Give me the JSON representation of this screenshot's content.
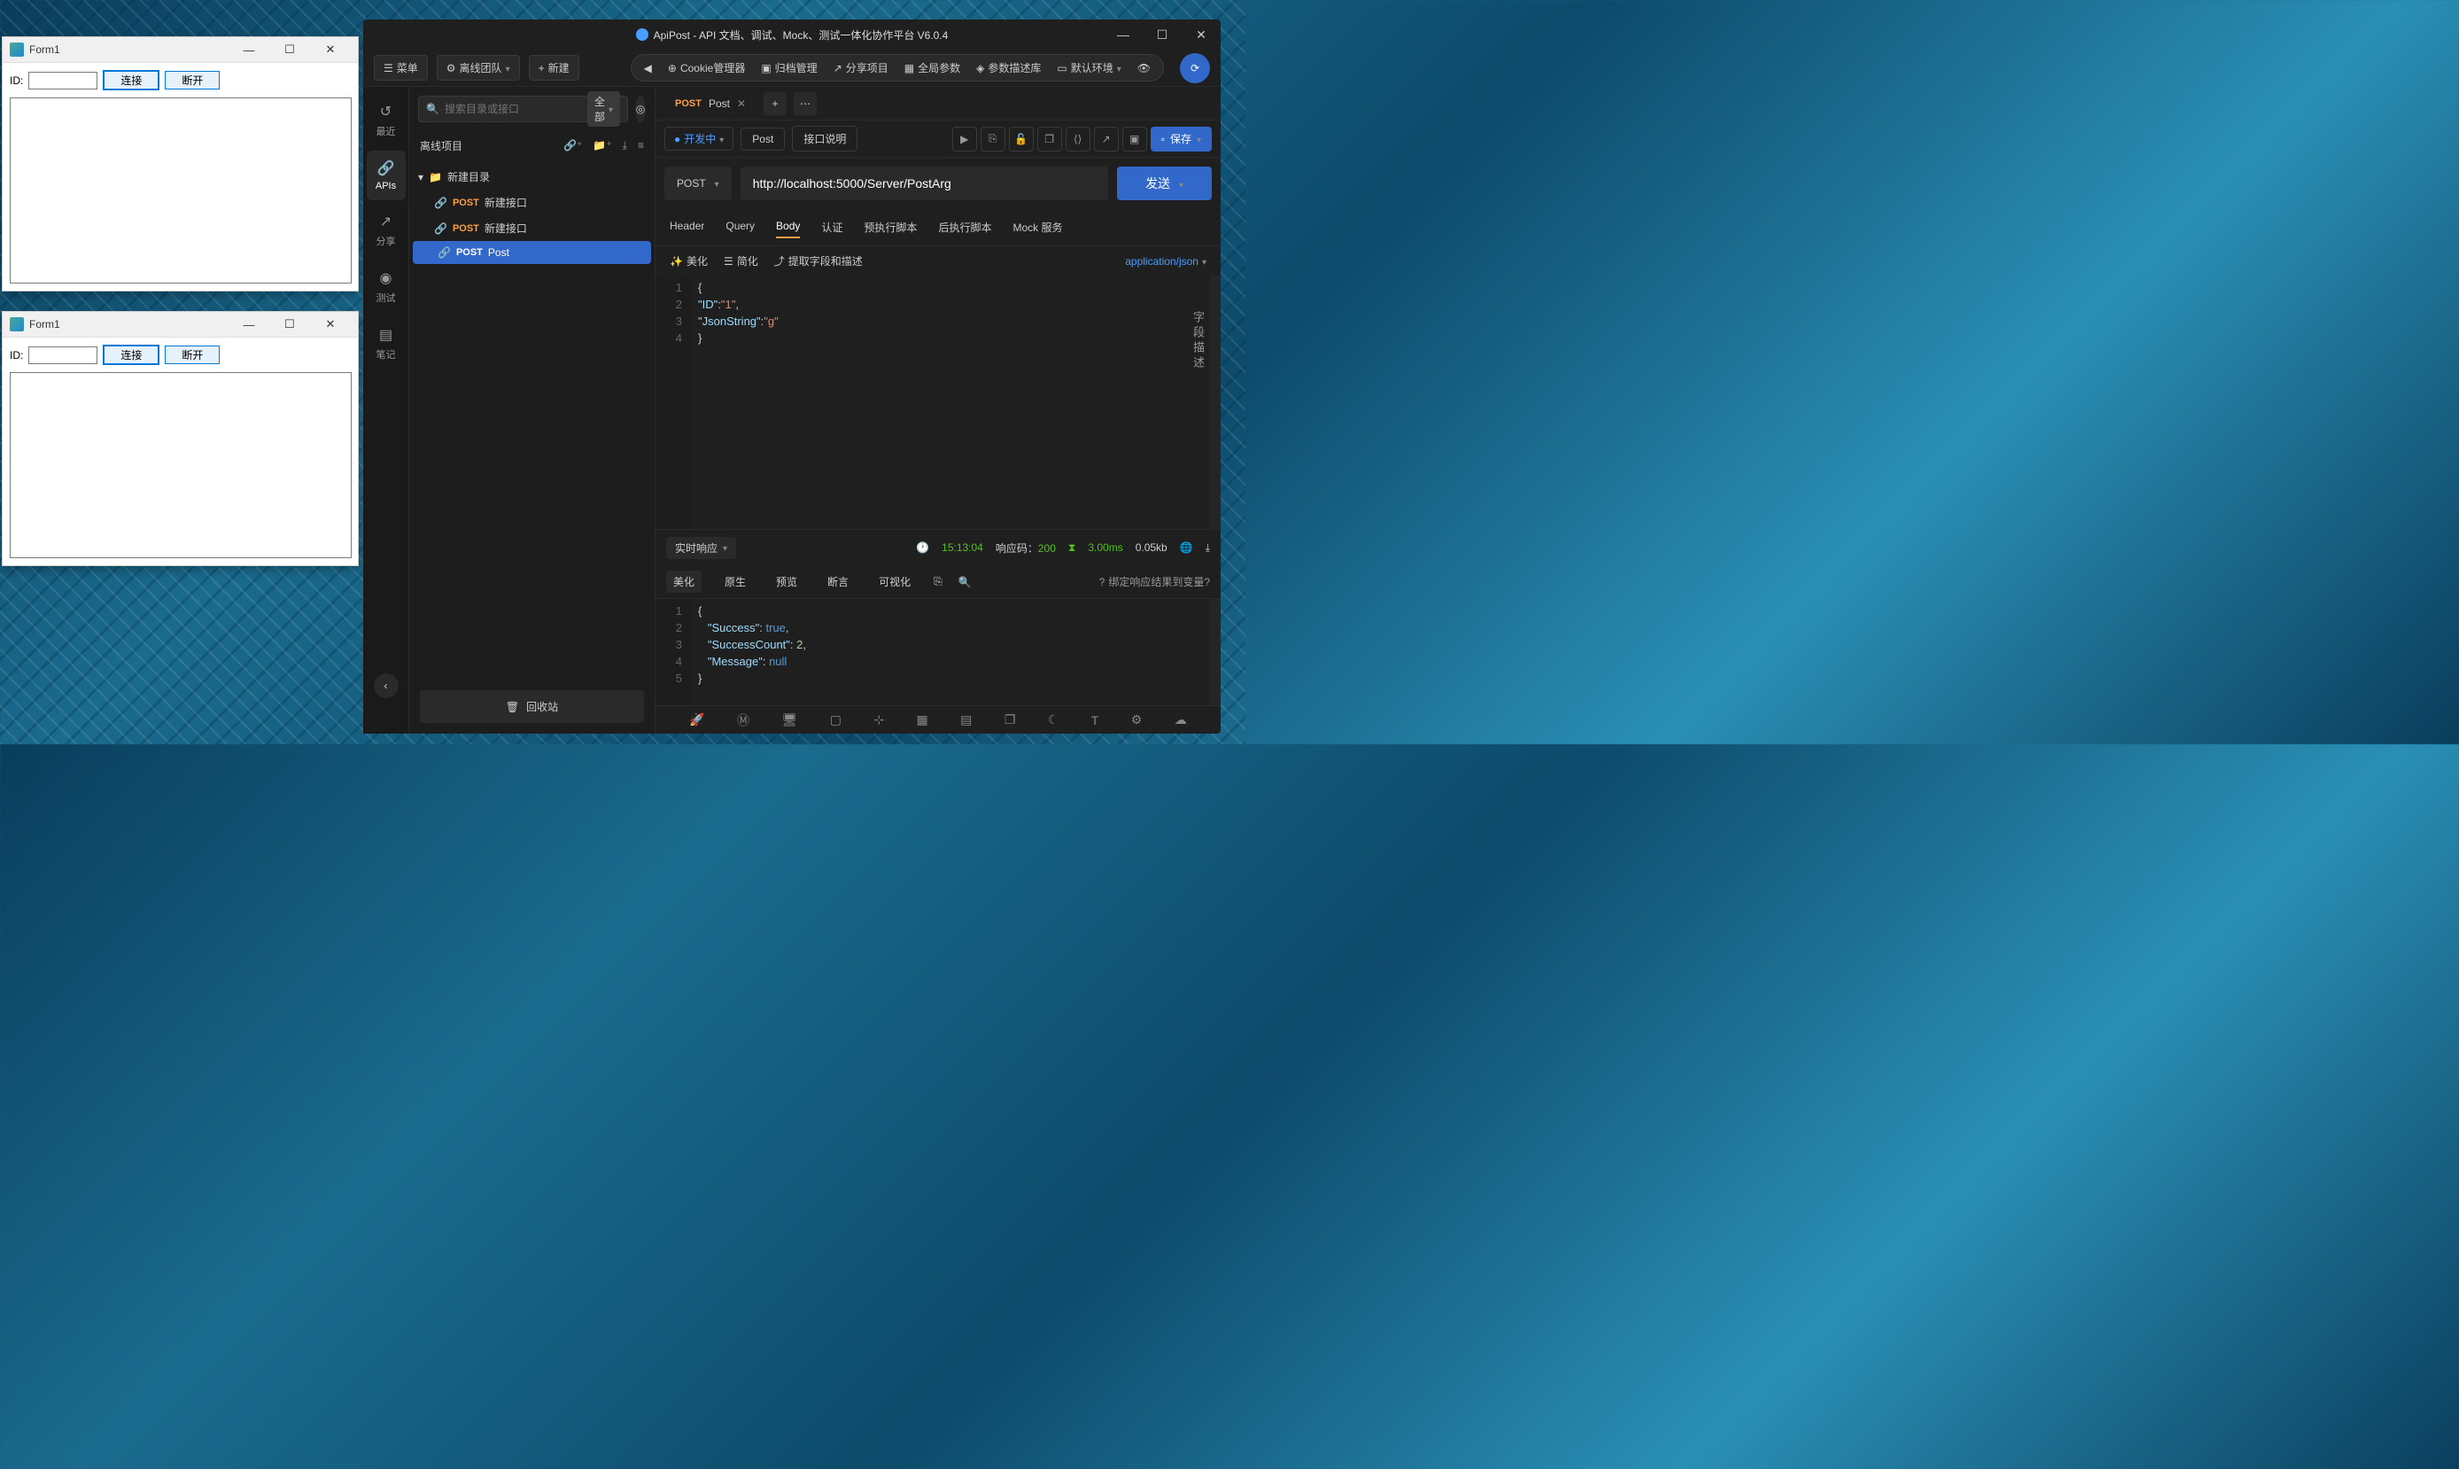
{
  "form1": {
    "title": "Form1",
    "id_label": "ID:",
    "connect": "连接",
    "disconnect": "断开"
  },
  "apipost": {
    "title": "ApiPost - API 文档、调试、Mock、测试一体化协作平台 V6.0.4",
    "menu": "菜单",
    "team": "离线团队",
    "new": "新建",
    "nav_back": "◀",
    "cookie": "Cookie管理器",
    "archive": "归档管理",
    "share": "分享项目",
    "global": "全局参数",
    "paramdesc": "参数描述库",
    "env": "默认环境",
    "rail": {
      "recent": "最近",
      "apis": "APIs",
      "share": "分享",
      "test": "测试",
      "notes": "笔记"
    },
    "sidebar": {
      "search_placeholder": "搜索目录或接口",
      "filter": "全部",
      "project": "离线项目",
      "folder": "新建目录",
      "items": [
        {
          "method": "POST",
          "name": "新建接口"
        },
        {
          "method": "POST",
          "name": "新建接口"
        },
        {
          "method": "POST",
          "name": "Post"
        }
      ],
      "recycle": "回收站"
    },
    "tab": {
      "method": "POST",
      "name": "Post"
    },
    "action": {
      "dev": "开发中",
      "post": "Post",
      "desc": "接口说明",
      "save": "保存"
    },
    "url": {
      "method": "POST",
      "value": "http://localhost:5000/Server/PostArg",
      "send": "发送"
    },
    "reqtabs": {
      "header": "Header",
      "query": "Query",
      "body": "Body",
      "auth": "认证",
      "prescript": "预执行脚本",
      "postscript": "后执行脚本",
      "mock": "Mock 服务"
    },
    "bodytools": {
      "beautify": "美化",
      "simplify": "简化",
      "extract": "提取字段和描述",
      "contenttype": "application/json"
    },
    "fieldlabel": "字段描述",
    "body_lines": [
      "1",
      "2",
      "3",
      "4"
    ],
    "response": {
      "mode": "实时响应",
      "time": "15:13:04",
      "code_label": "响应码：",
      "code": "200",
      "duration": "3.00ms",
      "size": "0.05kb",
      "tabs": {
        "beautify": "美化",
        "raw": "原生",
        "preview": "预览",
        "assert": "断言",
        "visual": "可视化"
      },
      "bind": "绑定响应结果到变量?",
      "lines": [
        "1",
        "2",
        "3",
        "4",
        "5"
      ]
    }
  }
}
